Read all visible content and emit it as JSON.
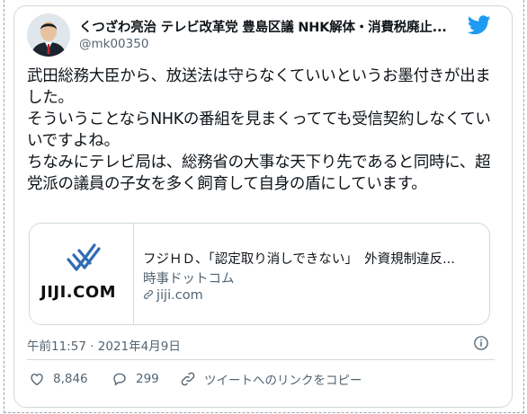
{
  "author": {
    "display_name": "くつざわ亮治 テレビ改革党 豊島区議 NHK解体・消費税廃止...",
    "handle": "@mk00350"
  },
  "tweet": {
    "text": "武田総務大臣から、放送法は守らなくていいというお墨付きが出ました。\nそういうことならNHKの番組を見まくってても受信契約しなくていいですよね。\nちなみにテレビ局は、総務省の大事な天下り先であると同時に、超党派の議員の子女を多く飼育して自身の盾にしています。",
    "timestamp": "午前11:57 · 2021年4月9日"
  },
  "link_card": {
    "thumbnail_text": "JIJI.COM",
    "title": "フジＨＤ、「認定取り消しできない」　外資規制違反...",
    "description": "時事ドットコム",
    "domain": "jiji.com"
  },
  "actions": {
    "like_count": "8,846",
    "reply_count": "299",
    "copy_link_label": "ツイートへのリンクをコピー"
  },
  "icons": {
    "twitter": "twitter-bird-icon",
    "info": "info-icon",
    "like": "heart-icon",
    "reply": "speech-bubble-icon",
    "copy_link": "link-icon"
  },
  "colors": {
    "twitter_blue": "#1d9bf0",
    "text_primary": "#0f1419",
    "text_secondary": "#536471",
    "border": "#cfd9de",
    "jiji_blue": "#2f6db5"
  }
}
